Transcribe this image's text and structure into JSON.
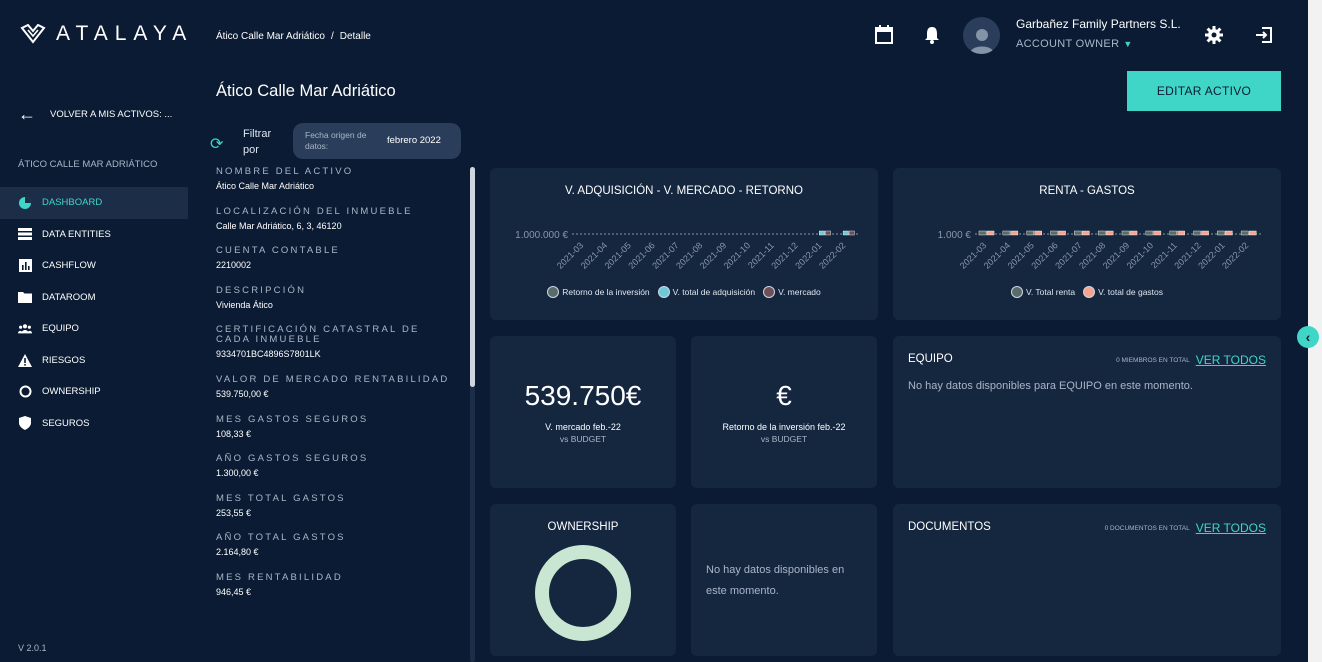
{
  "brand": {
    "name": "ATALAYA",
    "accent": "#3fd6c8"
  },
  "breadcrumb": {
    "parent": "Ático Calle Mar Adriático",
    "current": "Detalle"
  },
  "user": {
    "name": "Garbañez Family Partners S.L.",
    "role": "ACCOUNT OWNER"
  },
  "sidebar": {
    "back_label": "VOLVER A MIS ACTIVOS: ...",
    "asset_caption": "ÁTICO CALLE MAR ADRIÁTICO",
    "items": [
      {
        "label": "DASHBOARD",
        "icon": "pie-chart-icon",
        "active": true
      },
      {
        "label": "DATA ENTITIES",
        "icon": "list-icon"
      },
      {
        "label": "CASHFLOW",
        "icon": "bar-chart-icon"
      },
      {
        "label": "DATAROOM",
        "icon": "folder-icon"
      },
      {
        "label": "EQUIPO",
        "icon": "team-icon"
      },
      {
        "label": "RIESGOS",
        "icon": "warning-icon"
      },
      {
        "label": "OWNERSHIP",
        "icon": "circle-icon"
      },
      {
        "label": "SEGUROS",
        "icon": "shield-icon"
      }
    ],
    "version": "V 2.0.1"
  },
  "page": {
    "title": "Ático Calle Mar Adriático",
    "edit_label": "EDITAR ACTIVO",
    "filter": {
      "label": "Filtrar por",
      "key": "Fecha origen de datos:",
      "value": "febrero 2022"
    }
  },
  "details": [
    {
      "label": "NOMBRE DEL ACTIVO",
      "value": "Ático Calle Mar Adriático"
    },
    {
      "label": "LOCALIZACIÓN DEL INMUEBLE",
      "value": "Calle Mar Adriático, 6, 3, 46120"
    },
    {
      "label": "CUENTA CONTABLE",
      "value": "2210002"
    },
    {
      "label": "DESCRIPCIÓN",
      "value": "Vivienda Ático"
    },
    {
      "label": "CERTIFICACIÓN CATASTRAL DE CADA INMUEBLE",
      "value": "9334701BC4896S7801LK"
    },
    {
      "label": "VALOR DE MERCADO RENTABILIDAD",
      "value": "539.750,00 €"
    },
    {
      "label": "MES GASTOS SEGUROS",
      "value": "108,33 €"
    },
    {
      "label": "AÑO GASTOS SEGUROS",
      "value": "1.300,00 €"
    },
    {
      "label": "MES TOTAL GASTOS",
      "value": "253,55 €"
    },
    {
      "label": "AÑO TOTAL GASTOS",
      "value": "2.164,80 €"
    },
    {
      "label": "MES RENTABILIDAD",
      "value": "946,45 €"
    }
  ],
  "cards": {
    "market": {
      "value": "539.750€",
      "label": "V. mercado feb.-22",
      "sub": "vs BUDGET"
    },
    "return": {
      "value": "€",
      "label": "Retorno de la inversión feb.-22",
      "sub": "vs BUDGET"
    },
    "team": {
      "title": "EQUIPO",
      "count": "0 MIEMBROS EN TOTAL",
      "link": "VER TODOS",
      "empty": "No hay datos disponibles para EQUIPO en este momento."
    },
    "ownership": {
      "title": "OWNERSHIP",
      "empty": "No hay datos disponibles en este momento."
    },
    "documents": {
      "title": "DOCUMENTOS",
      "count": "0 DOCUMENTOS EN TOTAL",
      "link": "VER TODOS"
    }
  },
  "chart_data": [
    {
      "type": "bar",
      "title": "V. ADQUISICIÓN - V. MERCADO - RETORNO",
      "y_tick_label": "1.000.000 €",
      "categories": [
        "2021-03",
        "2021-04",
        "2021-05",
        "2021-06",
        "2021-07",
        "2021-08",
        "2021-09",
        "2021-10",
        "2021-11",
        "2021-12",
        "2022-01",
        "2022-02"
      ],
      "series": [
        {
          "name": "Retorno de la inversión",
          "color": "#5a6b6a"
        },
        {
          "name": "V. total de adquisición",
          "color": "#6fc9d8"
        },
        {
          "name": "V. mercado",
          "color": "#6e4f57"
        }
      ]
    },
    {
      "type": "bar",
      "title": "RENTA - GASTOS",
      "y_tick_label": "1.000 €",
      "categories": [
        "2021-03",
        "2021-04",
        "2021-05",
        "2021-06",
        "2021-07",
        "2021-08",
        "2021-09",
        "2021-10",
        "2021-11",
        "2021-12",
        "2022-01",
        "2022-02"
      ],
      "series": [
        {
          "name": "V. Total renta",
          "color": "#5a6b6a"
        },
        {
          "name": "V. total de gastos",
          "color": "#f5a58f"
        }
      ]
    },
    {
      "type": "pie",
      "title": "OWNERSHIP",
      "series": [
        {
          "color": "#c9e6d2"
        }
      ]
    }
  ]
}
